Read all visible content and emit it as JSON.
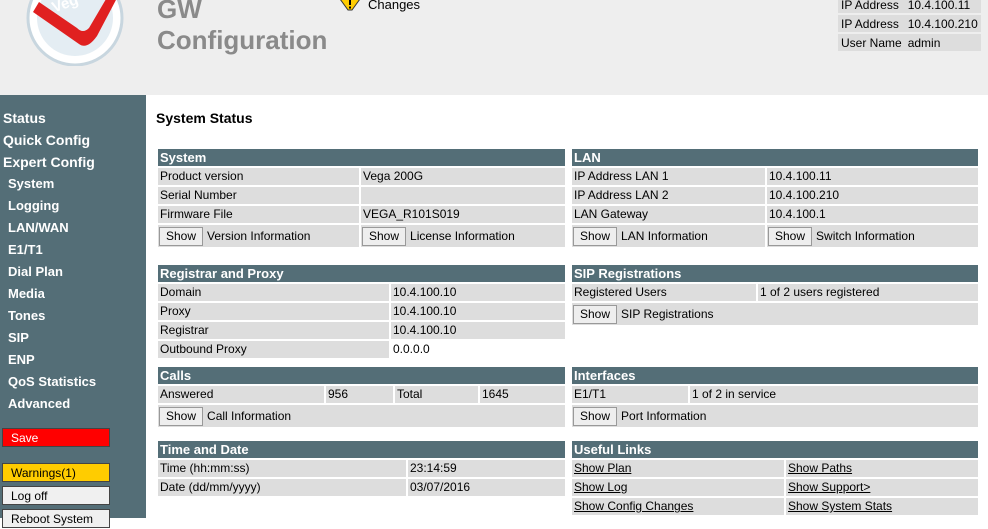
{
  "header": {
    "title_line1": "GW",
    "title_line2": "Configuration",
    "changes_label": "Changes",
    "info": [
      {
        "label": "IP Address",
        "value": "10.4.100.11"
      },
      {
        "label": "IP Address",
        "value": "10.4.100.210"
      },
      {
        "label": "User Name",
        "value": "admin"
      }
    ]
  },
  "sidebar": {
    "items": [
      {
        "label": "Status"
      },
      {
        "label": "Quick Config"
      },
      {
        "label": "Expert Config"
      },
      {
        "label": "System"
      },
      {
        "label": "Logging"
      },
      {
        "label": "LAN/WAN"
      },
      {
        "label": "E1/T1"
      },
      {
        "label": "Dial Plan"
      },
      {
        "label": "Media"
      },
      {
        "label": "Tones"
      },
      {
        "label": "SIP"
      },
      {
        "label": "ENP"
      },
      {
        "label": "QoS Statistics"
      },
      {
        "label": "Advanced"
      }
    ],
    "save_label": "Save",
    "warnings_label": "Warnings(1)",
    "logoff_label": "Log off",
    "reboot_label": "Reboot System"
  },
  "main": {
    "title": "System Status",
    "system": {
      "heading": "System",
      "product_label": "Product version",
      "product_value": "Vega 200G",
      "serial_label": "Serial Number",
      "serial_value": "",
      "firmware_label": "Firmware File",
      "firmware_value": "VEGA_R101S019",
      "show_label": "Show",
      "version_info": "Version Information",
      "license_info": "License Information"
    },
    "lan": {
      "heading": "LAN",
      "ip1_label": "IP Address LAN 1",
      "ip1_value": "10.4.100.11",
      "ip2_label": "IP Address LAN 2",
      "ip2_value": "10.4.100.210",
      "gw_label": "LAN Gateway",
      "gw_value": "10.4.100.1",
      "show_label": "Show",
      "lan_info": "LAN Information",
      "switch_info": "Switch Information"
    },
    "registrar": {
      "heading": "Registrar and Proxy",
      "domain_label": "Domain",
      "domain_value": "10.4.100.10",
      "proxy_label": "Proxy",
      "proxy_value": "10.4.100.10",
      "registrar_label": "Registrar",
      "registrar_value": "10.4.100.10",
      "outbound_label": "Outbound Proxy",
      "outbound_value": "0.0.0.0"
    },
    "sip_reg": {
      "heading": "SIP Registrations",
      "users_label": "Registered Users",
      "users_value": "1 of 2 users registered",
      "show_label": "Show",
      "info": "SIP Registrations"
    },
    "calls": {
      "heading": "Calls",
      "answered_label": "Answered",
      "answered_value": "956",
      "total_label": "Total",
      "total_value": "1645",
      "show_label": "Show",
      "info": "Call Information"
    },
    "interfaces": {
      "heading": "Interfaces",
      "e1_label": "E1/T1",
      "e1_value": "1 of 2 in service",
      "show_label": "Show",
      "info": "Port Information"
    },
    "time": {
      "heading": "Time and Date",
      "time_label": "Time (hh:mm:ss)",
      "time_value": "23:14:59",
      "date_label": "Date (dd/mm/yyyy)",
      "date_value": "03/07/2016"
    },
    "links": {
      "heading": "Useful Links",
      "show_plan": "Show Plan",
      "show_paths": "Show Paths",
      "show_log": "Show Log",
      "show_support": "Show Support>",
      "show_config_changes": "Show Config Changes",
      "show_system_stats": "Show System Stats"
    }
  }
}
